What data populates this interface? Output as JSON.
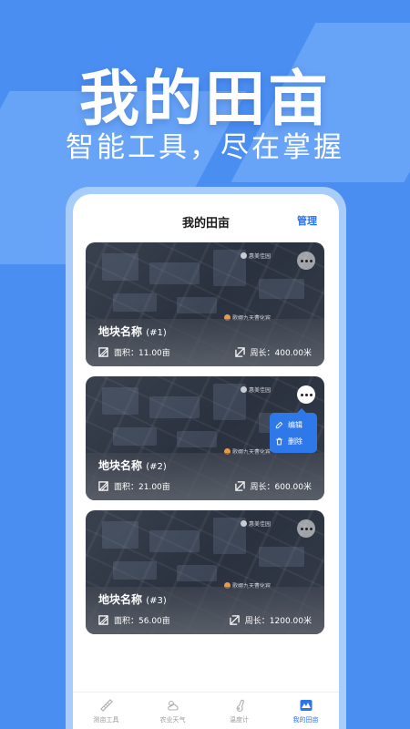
{
  "hero": {
    "title": "我的田亩",
    "subtitle": "智能工具，尽在掌握"
  },
  "screen": {
    "nav_title": "我的田亩",
    "nav_action": "管理"
  },
  "plots": [
    {
      "name": "地块名称",
      "number": "(#1)",
      "area_text": "面积：11.00亩",
      "perimeter_text": "周长：400.00米",
      "poi_top": "惠美佳园",
      "poi_bottom": "歌娜九天曹化宾",
      "menu_open": false
    },
    {
      "name": "地块名称",
      "number": "(#2)",
      "area_text": "面积：21.00亩",
      "perimeter_text": "周长：600.00米",
      "poi_top": "惠美佳园",
      "poi_bottom": "歌娜九天曹化宾",
      "menu_open": true
    },
    {
      "name": "地块名称",
      "number": "(#3)",
      "area_text": "面积：56.00亩",
      "perimeter_text": "周长：1200.00米",
      "poi_top": "惠美佳园",
      "poi_bottom": "歌娜九天曹化宾",
      "menu_open": false
    }
  ],
  "popup": {
    "edit": "编辑",
    "delete": "删除"
  },
  "tabs": [
    {
      "label": "测亩工具",
      "icon": "measure-icon",
      "active": false
    },
    {
      "label": "农业天气",
      "icon": "weather-icon",
      "active": false
    },
    {
      "label": "温度计",
      "icon": "thermometer-icon",
      "active": false
    },
    {
      "label": "我的田亩",
      "icon": "field-icon",
      "active": true
    }
  ],
  "colors": {
    "background": "#4b8ef2",
    "accent": "#2c74e8",
    "popup": "#2f78ea"
  }
}
